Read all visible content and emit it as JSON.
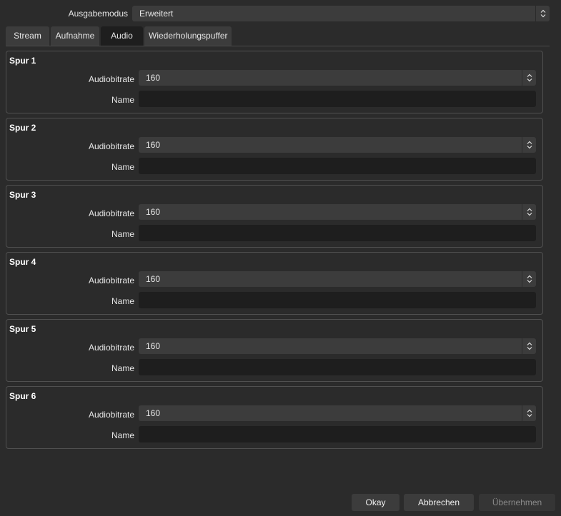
{
  "output_mode": {
    "label": "Ausgabemodus",
    "value": "Erweitert"
  },
  "tabs": [
    {
      "label": "Stream"
    },
    {
      "label": "Aufnahme"
    },
    {
      "label": "Audio",
      "active": true
    },
    {
      "label": "Wiederholungspuffer"
    }
  ],
  "tracks": [
    {
      "title": "Spur 1",
      "bitrate_label": "Audiobitrate",
      "bitrate": "160",
      "name_label": "Name",
      "name": ""
    },
    {
      "title": "Spur 2",
      "bitrate_label": "Audiobitrate",
      "bitrate": "160",
      "name_label": "Name",
      "name": ""
    },
    {
      "title": "Spur 3",
      "bitrate_label": "Audiobitrate",
      "bitrate": "160",
      "name_label": "Name",
      "name": ""
    },
    {
      "title": "Spur 4",
      "bitrate_label": "Audiobitrate",
      "bitrate": "160",
      "name_label": "Name",
      "name": ""
    },
    {
      "title": "Spur 5",
      "bitrate_label": "Audiobitrate",
      "bitrate": "160",
      "name_label": "Name",
      "name": ""
    },
    {
      "title": "Spur 6",
      "bitrate_label": "Audiobitrate",
      "bitrate": "160",
      "name_label": "Name",
      "name": ""
    }
  ],
  "buttons": {
    "ok": "Okay",
    "cancel": "Abbrechen",
    "apply": "Übernehmen"
  },
  "colors": {
    "background": "#2b2b2b",
    "control": "#3c3c3c",
    "field_dark": "#1e1e1e",
    "border": "#505050"
  }
}
